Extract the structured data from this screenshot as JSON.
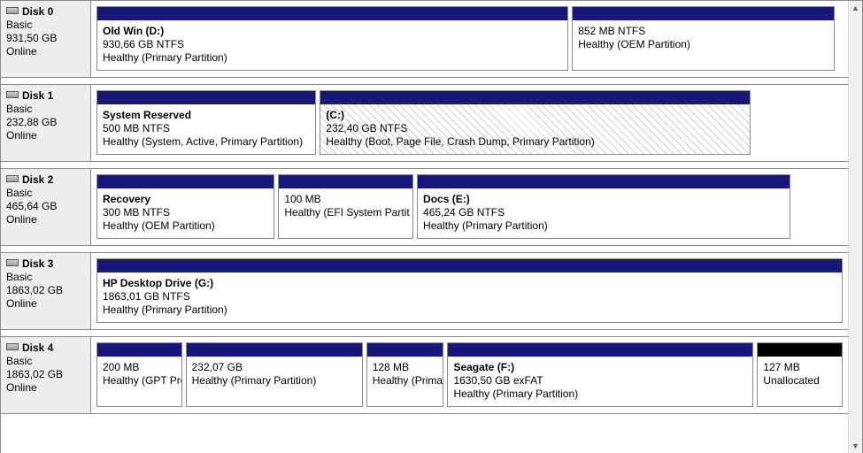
{
  "disks": [
    {
      "name": "Disk 0",
      "type": "Basic",
      "size": "931,50 GB",
      "status": "Online",
      "partitions": [
        {
          "label": "Old Win  (D:)",
          "line1": "930,66 GB NTFS",
          "line2": "Healthy (Primary Partition)",
          "bar": "navy",
          "flex": 544,
          "hatched": false
        },
        {
          "label": "",
          "line1": "852 MB NTFS",
          "line2": "Healthy (OEM Partition)",
          "bar": "navy",
          "flex": 302,
          "hatched": false
        }
      ],
      "trailing": 5
    },
    {
      "name": "Disk 1",
      "type": "Basic",
      "size": "232,88 GB",
      "status": "Online",
      "partitions": [
        {
          "label": "System Reserved",
          "line1": "500 MB NTFS",
          "line2": "Healthy (System, Active, Primary Partition)",
          "bar": "navy",
          "flex": 246,
          "hatched": false
        },
        {
          "label": "(C:)",
          "line1": "232,40 GB NTFS",
          "line2": "Healthy (Boot, Page File, Crash Dump, Primary Partition)",
          "bar": "navy",
          "flex": 484,
          "hatched": true
        }
      ],
      "trailing": 100
    },
    {
      "name": "Disk 2",
      "type": "Basic",
      "size": "465,64 GB",
      "status": "Online",
      "partitions": [
        {
          "label": "Recovery",
          "line1": "300 MB NTFS",
          "line2": "Healthy (OEM Partition)",
          "bar": "navy",
          "flex": 201,
          "hatched": false
        },
        {
          "label": "",
          "line1": "100 MB",
          "line2": "Healthy (EFI System Partit",
          "bar": "navy",
          "flex": 152,
          "hatched": false
        },
        {
          "label": "Docs  (E:)",
          "line1": "465,24 GB NTFS",
          "line2": "Healthy (Primary Partition)",
          "bar": "navy",
          "flex": 424,
          "hatched": false
        }
      ],
      "trailing": 55
    },
    {
      "name": "Disk 3",
      "type": "Basic",
      "size": "1863,02 GB",
      "status": "Online",
      "partitions": [
        {
          "label": "HP Desktop Drive  (G:)",
          "line1": "1863,01 GB NTFS",
          "line2": "Healthy (Primary Partition)",
          "bar": "navy",
          "flex": 844,
          "hatched": false
        }
      ],
      "trailing": 0
    },
    {
      "name": "Disk 4",
      "type": "Basic",
      "size": "1863,02 GB",
      "status": "Online",
      "partitions": [
        {
          "label": "",
          "line1": "200 MB",
          "line2": "Healthy (GPT Pro",
          "bar": "navy",
          "flex": 96,
          "hatched": false
        },
        {
          "label": "",
          "line1": "232,07 GB",
          "line2": "Healthy (Primary Partition)",
          "bar": "navy",
          "flex": 201,
          "hatched": false
        },
        {
          "label": "",
          "line1": "128 MB",
          "line2": "Healthy (Primar",
          "bar": "navy",
          "flex": 87,
          "hatched": false
        },
        {
          "label": "Seagate  (F:)",
          "line1": "1630,50 GB exFAT",
          "line2": "Healthy (Primary Partition)",
          "bar": "navy",
          "flex": 349,
          "hatched": false
        },
        {
          "label": "",
          "line1": "127 MB",
          "line2": "Unallocated",
          "bar": "black",
          "flex": 96,
          "hatched": false
        }
      ],
      "trailing": 0
    }
  ]
}
